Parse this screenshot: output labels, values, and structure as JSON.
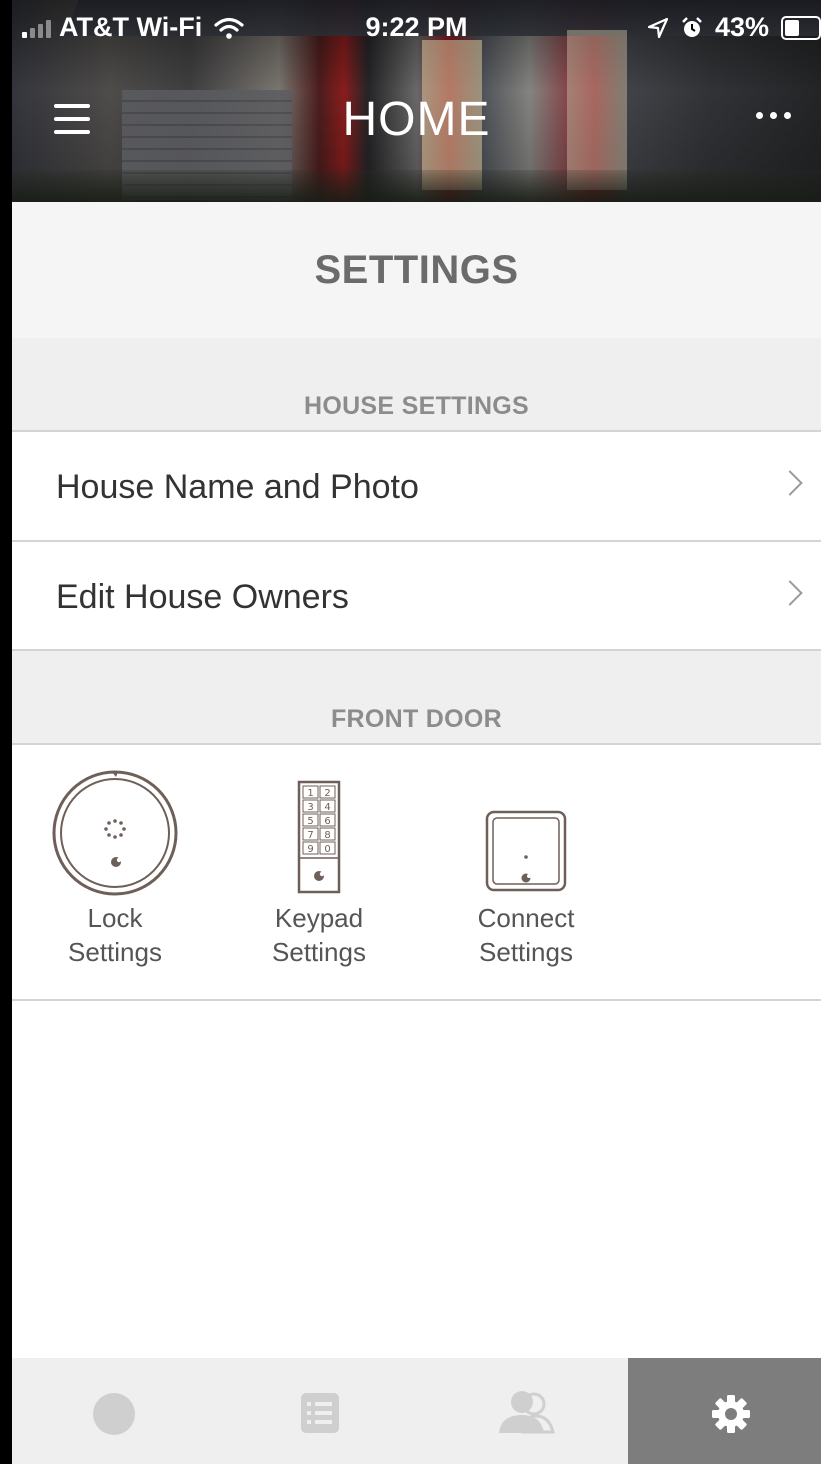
{
  "status_bar": {
    "carrier": "AT&T Wi-Fi",
    "time": "9:22 PM",
    "battery": "43%",
    "icons": [
      "signal-icon",
      "wifi-icon",
      "location-icon",
      "alarm-icon",
      "battery-icon"
    ]
  },
  "header": {
    "title": "HOME",
    "menu_icon": "hamburger-icon",
    "more_icon": "more-icon"
  },
  "page": {
    "title": "SETTINGS"
  },
  "house_settings": {
    "section_label": "HOUSE SETTINGS",
    "items": [
      {
        "label": "House Name and Photo"
      },
      {
        "label": "Edit House Owners"
      }
    ]
  },
  "front_door": {
    "section_label": "FRONT DOOR",
    "devices": [
      {
        "label_line1": "Lock",
        "label_line2": "Settings",
        "icon": "lock-device-icon"
      },
      {
        "label_line1": "Keypad",
        "label_line2": "Settings",
        "icon": "keypad-device-icon"
      },
      {
        "label_line1": "Connect",
        "label_line2": "Settings",
        "icon": "connect-device-icon"
      }
    ],
    "keypad_keys": [
      "1",
      "2",
      "3",
      "4",
      "5",
      "6",
      "7",
      "8",
      "9",
      "0"
    ]
  },
  "tabbar": {
    "tabs": [
      {
        "icon": "lock-status-icon",
        "active": false
      },
      {
        "icon": "activity-list-icon",
        "active": false
      },
      {
        "icon": "guests-icon",
        "active": false
      },
      {
        "icon": "gear-icon",
        "active": true
      }
    ]
  },
  "colors": {
    "tab_active": "#7d7d7d",
    "tab_bar": "#efefef",
    "text_primary": "#333333",
    "section_label": "#8c8c8c",
    "device_stroke": "#6e5f58"
  }
}
